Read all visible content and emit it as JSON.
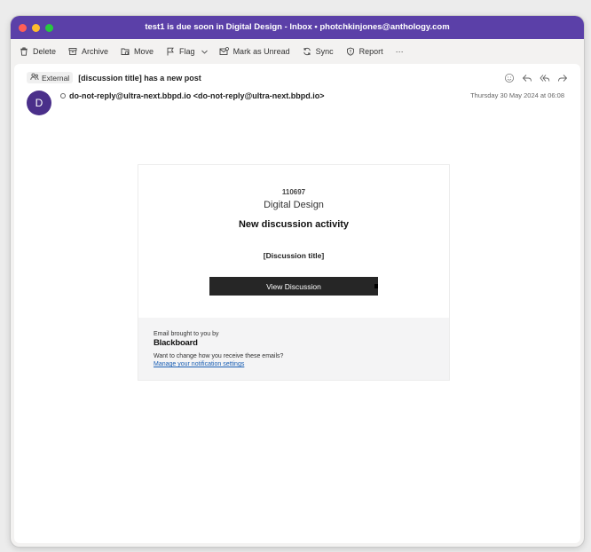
{
  "window": {
    "title": "test1 is due soon in Digital Design - Inbox • photchkinjones@anthology.com"
  },
  "toolbar": {
    "delete_label": "Delete",
    "archive_label": "Archive",
    "move_label": "Move",
    "flag_label": "Flag",
    "mark_unread_label": "Mark as Unread",
    "sync_label": "Sync",
    "report_label": "Report",
    "more_label": "···"
  },
  "message": {
    "external_badge": "External",
    "subject": "[discussion title] has a new post",
    "avatar_initial": "D",
    "sender": "do-not-reply@ultra-next.bbpd.io <do-not-reply@ultra-next.bbpd.io>",
    "date": "Thursday 30 May 2024 at 06:08"
  },
  "email": {
    "course_id": "110697",
    "course_name": "Digital Design",
    "activity_title": "New discussion activity",
    "discussion_title": "[Discussion title]",
    "button_label": "View Discussion",
    "footer_brought": "Email brought to you by",
    "brand": "Blackboard",
    "footer_question": "Want to change how you receive these emails?",
    "footer_link": "Manage your notification settings"
  },
  "colors": {
    "titlebar": "#5b40a8",
    "avatar": "#4a2f8a",
    "button": "#262626",
    "link": "#1a5fb4"
  }
}
